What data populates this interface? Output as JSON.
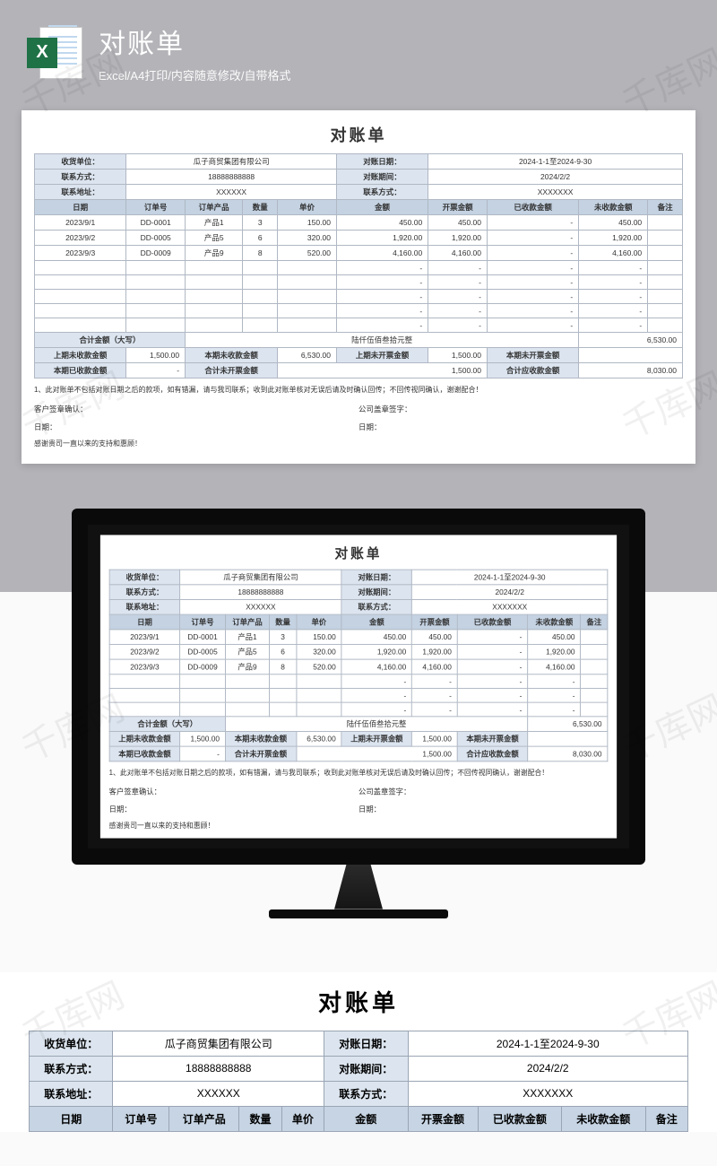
{
  "watermark": "千库网",
  "header": {
    "title": "对账单",
    "subtitle": "Excel/A4打印/内容随意修改/自带格式",
    "icon_letter": "X"
  },
  "sheet": {
    "title": "对账单",
    "info_left": {
      "l1": "收货单位：",
      "v1": "瓜子商贸集团有限公司",
      "l2": "联系方式：",
      "v2": "18888888888",
      "l3": "联系地址：",
      "v3": "XXXXXX"
    },
    "info_right": {
      "l1": "对账日期：",
      "v1": "2024-1-1至2024-9-30",
      "l2": "对账期间：",
      "v2": "2024/2/2",
      "l3": "联系方式：",
      "v3": "XXXXXXX"
    },
    "columns": [
      "日期",
      "订单号",
      "订单产品",
      "数量",
      "单价",
      "金额",
      "开票金额",
      "已收款金额",
      "未收款金额",
      "备注"
    ],
    "rows": [
      {
        "date": "2023/9/1",
        "order": "DD-0001",
        "prod": "产品1",
        "qty": "3",
        "price": "150.00",
        "amt": "450.00",
        "inv": "450.00",
        "recv": "-",
        "unrecv": "450.00",
        "note": ""
      },
      {
        "date": "2023/9/2",
        "order": "DD-0005",
        "prod": "产品5",
        "qty": "6",
        "price": "320.00",
        "amt": "1,920.00",
        "inv": "1,920.00",
        "recv": "-",
        "unrecv": "1,920.00",
        "note": ""
      },
      {
        "date": "2023/9/3",
        "order": "DD-0009",
        "prod": "产品9",
        "qty": "8",
        "price": "520.00",
        "amt": "4,160.00",
        "inv": "4,160.00",
        "recv": "-",
        "unrecv": "4,160.00",
        "note": ""
      }
    ],
    "blank_dash": "-",
    "sum_label": "合计金额（大写）",
    "sum_cn": "陆仟伍佰叁拾元整",
    "sum_val": "6,530.00",
    "summary": {
      "r1c1l": "上期未收款金额",
      "r1c1v": "1,500.00",
      "r1c2l": "本期未收款金额",
      "r1c2v": "6,530.00",
      "r1c3l": "上期未开票金额",
      "r1c3v": "1,500.00",
      "r1c4l": "本期未开票金额",
      "r1c4v": "",
      "r2c1l": "本期已收款金额",
      "r2c1v": "-",
      "r2c2l": "合计未开票金额",
      "r2c2v": "1,500.00",
      "r2c3l": "合计应收款金额",
      "r2c3v": "8,030.00"
    },
    "note1": "1、此对账单不包括对账日期之后的款项，如有错漏，请与我司联系；收到此对账单核对无误后请及时确认回传；不回传视同确认，谢谢配合！",
    "sig_customer": "客户签章确认：",
    "sig_company": "公司盖章签字：",
    "sig_date": "日期：",
    "thanks": "感谢贵司一直以来的支持和惠顾！"
  },
  "chart_data": {
    "type": "table",
    "title": "对账单",
    "columns": [
      "日期",
      "订单号",
      "订单产品",
      "数量",
      "单价",
      "金额",
      "开票金额",
      "已收款金额",
      "未收款金额",
      "备注"
    ],
    "rows": [
      [
        "2023/9/1",
        "DD-0001",
        "产品1",
        3,
        150.0,
        450.0,
        450.0,
        null,
        450.0,
        ""
      ],
      [
        "2023/9/2",
        "DD-0005",
        "产品5",
        6,
        320.0,
        1920.0,
        1920.0,
        null,
        1920.0,
        ""
      ],
      [
        "2023/9/3",
        "DD-0009",
        "产品9",
        8,
        520.0,
        4160.0,
        4160.0,
        null,
        4160.0,
        ""
      ]
    ],
    "totals": {
      "合计金额": 6530.0,
      "合计应收款金额": 8030.0,
      "上期未收款金额": 1500.0,
      "本期未收款金额": 6530.0
    }
  }
}
